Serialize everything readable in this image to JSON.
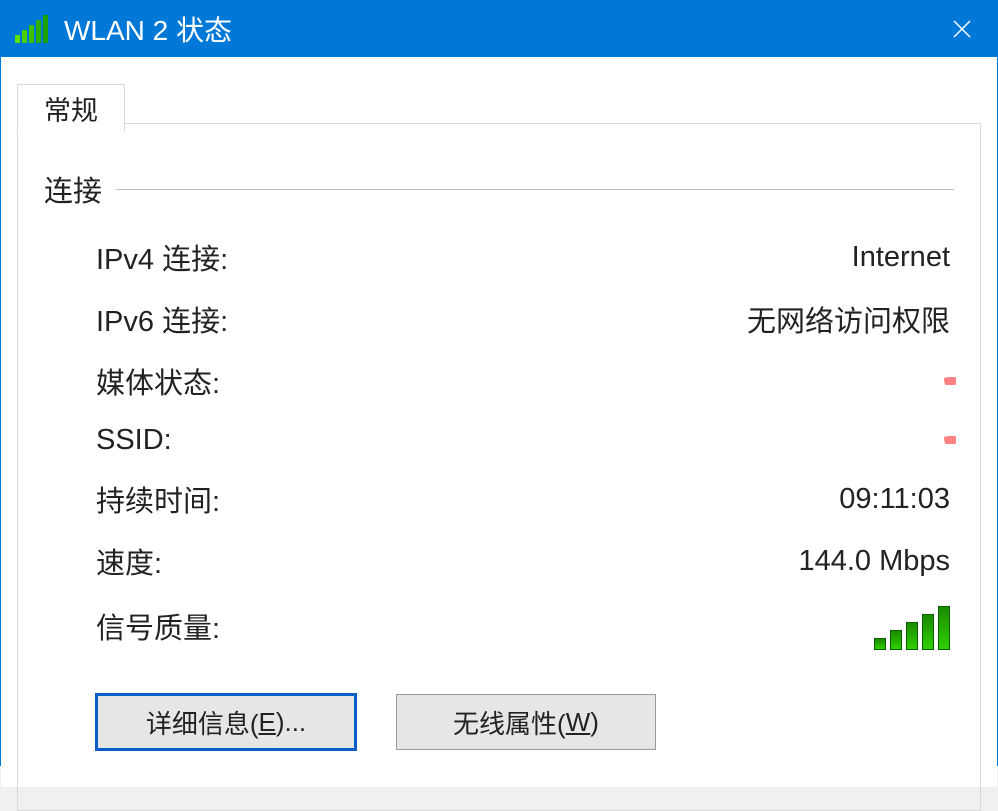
{
  "titlebar": {
    "title": "WLAN 2 状态"
  },
  "tabs": {
    "general": "常规"
  },
  "group": {
    "connection": "连接"
  },
  "fields": {
    "ipv4_label": "IPv4 连接:",
    "ipv4_value": "Internet",
    "ipv6_label": "IPv6 连接:",
    "ipv6_value": "无网络访问权限",
    "media_label": "媒体状态:",
    "ssid_label": "SSID:",
    "duration_label": "持续时间:",
    "duration_value": "09:11:03",
    "speed_label": "速度:",
    "speed_value": "144.0 Mbps",
    "signal_label": "信号质量:"
  },
  "buttons": {
    "details_pre": "详细信息(",
    "details_key": "E",
    "details_post": ")...",
    "wireless_pre": "无线属性(",
    "wireless_key": "W",
    "wireless_post": ")"
  }
}
